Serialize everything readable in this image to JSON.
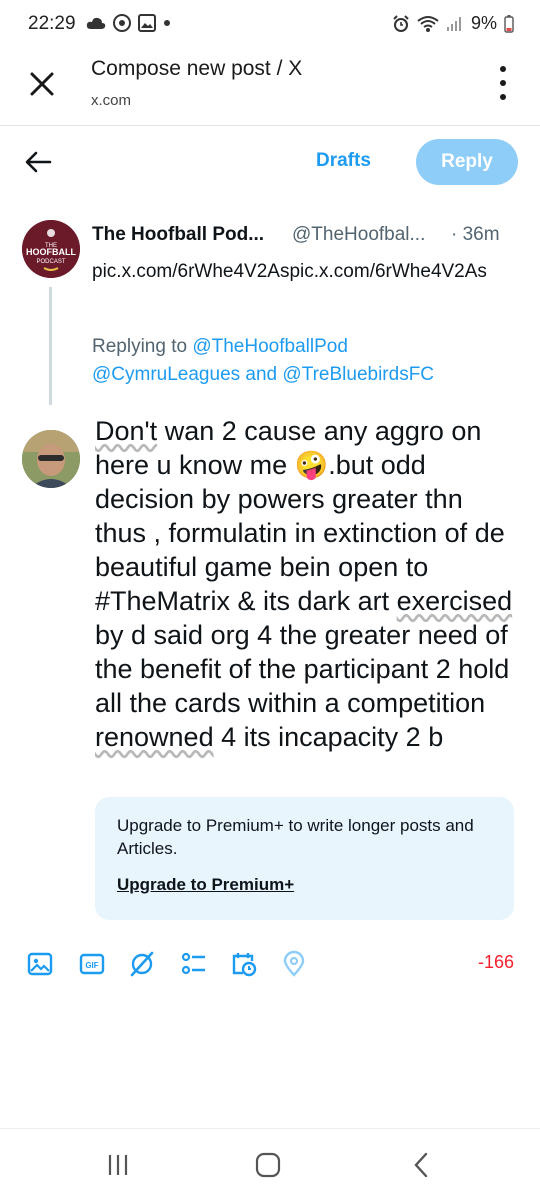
{
  "status_bar": {
    "time": "22:29",
    "battery": "9%",
    "left_icons": [
      "cloud-icon",
      "chrome-icon",
      "image-icon",
      "dot-icon"
    ],
    "right_icons": [
      "alarm-icon",
      "wifi-icon",
      "signal-icon",
      "battery-icon"
    ]
  },
  "browser": {
    "title": "Compose new post / X",
    "url": "x.com"
  },
  "compose_header": {
    "drafts_label": "Drafts",
    "reply_label": "Reply"
  },
  "original_post": {
    "display_name": "The Hoofball Pod...",
    "handle": "@TheHoofbal...",
    "time": "· 36m",
    "text": "pic.x.com/6rWhe4V2Aspic.x.com/6rWhe4V2As",
    "avatar_text": [
      "THE",
      "HOOFBALL",
      "PODCAST"
    ],
    "replying_prefix": "Replying to",
    "replying_handle_1": "@TheHoofballPod",
    "replying_handle_2": "@CymruLeagues",
    "replying_and": "and",
    "replying_handle_3": "@TreBluebirdsFC"
  },
  "composer": {
    "w1": "Don't",
    "t1": " wan 2 cause any aggro on here u know me 🤪.but odd decision by powers greater thn thus , formulatin in extinction of de beautiful game bein open to #TheMatrix & its dark art ",
    "w2": "exercised",
    "t2": " by d said org 4 the greater need of the  benefit of the participant 2 hold all the cards within a competition ",
    "w3": "renowned",
    "t3": " 4 its incapacity 2 b"
  },
  "upgrade": {
    "text": "Upgrade to Premium+ to write longer posts and Articles.",
    "link": "Upgrade to Premium+"
  },
  "toolbar": {
    "icons": [
      "image-icon",
      "gif-icon",
      "grok-icon",
      "poll-icon",
      "schedule-icon",
      "location-icon"
    ],
    "char_count": "-166"
  },
  "colors": {
    "accent": "#1d9bf0",
    "reply_disabled": "#8ecdf8",
    "over_limit": "#f4212e",
    "upgrade_bg": "#e8f5fd"
  }
}
